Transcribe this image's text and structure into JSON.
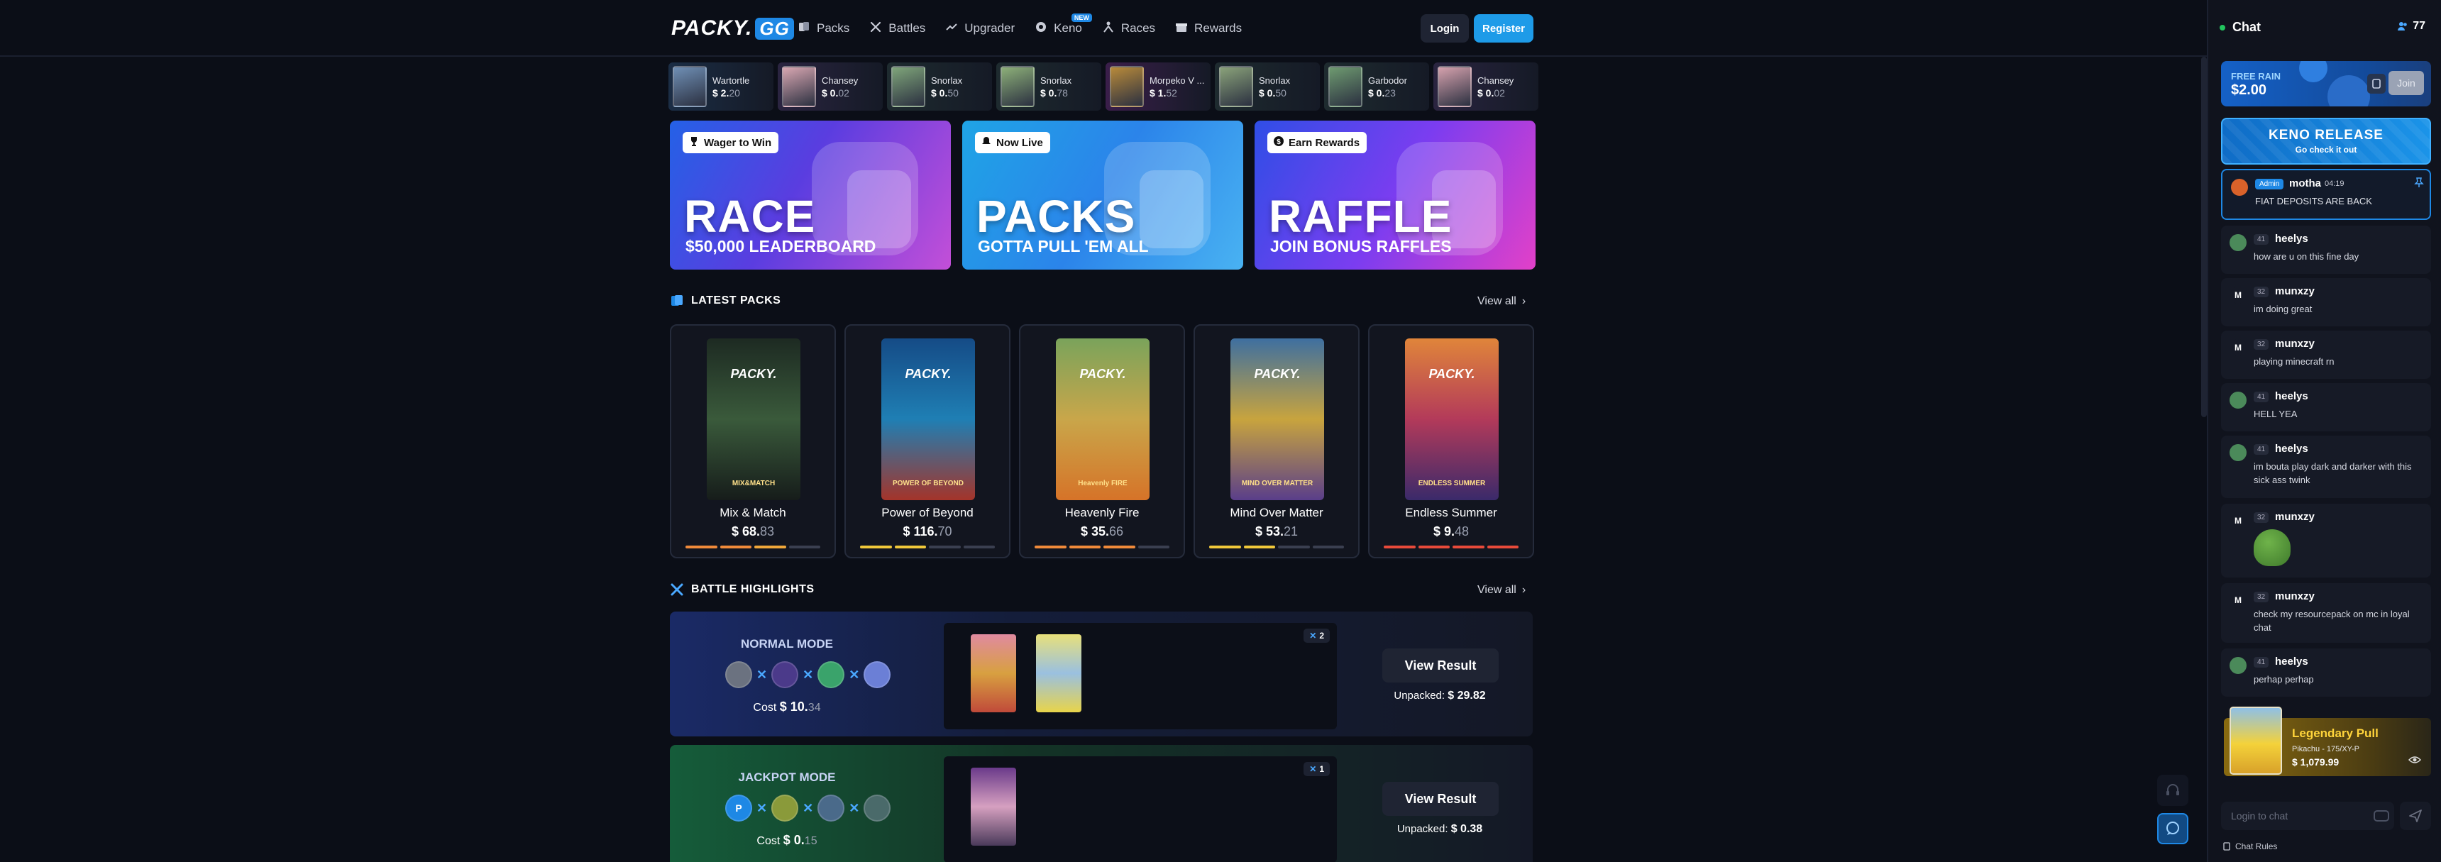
{
  "header": {
    "logo_text": "PACKY.",
    "logo_badge": "GG",
    "nav": [
      {
        "label": "Packs",
        "icon": "cards-icon"
      },
      {
        "label": "Battles",
        "icon": "swords-icon"
      },
      {
        "label": "Upgrader",
        "icon": "trend-up-icon"
      },
      {
        "label": "Keno",
        "icon": "keno-ball-icon",
        "badge": "NEW"
      },
      {
        "label": "Races",
        "icon": "race-icon"
      },
      {
        "label": "Rewards",
        "icon": "gift-icon"
      }
    ],
    "login_label": "Login",
    "register_label": "Register"
  },
  "ticker": [
    {
      "name": "Wartortle",
      "price_int": "$ 2.",
      "price_dec": "20",
      "bg": "#1b2d45",
      "card": "#6f8fb5"
    },
    {
      "name": "Chansey",
      "price_int": "$ 0.",
      "price_dec": "02",
      "bg": "#2a2440",
      "card": "#d9a7b2"
    },
    {
      "name": "Snorlax",
      "price_int": "$ 0.",
      "price_dec": "50",
      "bg": "#1e2b2f",
      "card": "#7fa57a"
    },
    {
      "name": "Snorlax",
      "price_int": "$ 0.",
      "price_dec": "78",
      "bg": "#1e2b2f",
      "card": "#8db079"
    },
    {
      "name": "Morpeko V ...",
      "price_int": "$ 1.",
      "price_dec": "52",
      "bg": "#3a1e4a",
      "card": "#b88a3a"
    },
    {
      "name": "Snorlax",
      "price_int": "$ 0.",
      "price_dec": "50",
      "bg": "#1e2b2f",
      "card": "#8aa27a"
    },
    {
      "name": "Garbodor",
      "price_int": "$ 0.",
      "price_dec": "23",
      "bg": "#1e2b2f",
      "card": "#6e9a70"
    },
    {
      "name": "Chansey",
      "price_int": "$ 0.",
      "price_dec": "02",
      "bg": "#2a2440",
      "card": "#d5a1ad"
    }
  ],
  "banners": [
    {
      "badge": "Wager to Win",
      "icon": "trophy-icon",
      "title": "RACE",
      "subtitle": "$50,000 LEADERBOARD",
      "bg": "linear-gradient(120deg,#2461e6 0%,#5a3de0 45%,#c34fd8 100%)"
    },
    {
      "badge": "Now Live",
      "icon": "bell-icon",
      "title": "PACKS",
      "subtitle": "GOTTA PULL 'EM ALL",
      "bg": "linear-gradient(120deg,#1fa4e6 0%,#2b84ea 50%,#49b2f2 100%)"
    },
    {
      "badge": "Earn Rewards",
      "icon": "dollar-icon",
      "title": "RAFFLE",
      "subtitle": "JOIN BONUS RAFFLES",
      "bg": "linear-gradient(120deg,#2f4ee6 0%,#7b3df0 50%,#e240c8 100%)"
    }
  ],
  "latest_packs": {
    "title": "LATEST PACKS",
    "view_all": "View all",
    "items": [
      {
        "name": "Mix & Match",
        "price_int": "$ 68.",
        "price_dec": "83",
        "art": "linear-gradient(180deg,#1d2a22,#3a5a3b 50%,#161c1a)",
        "label": "MIX&MATCH",
        "bar": [
          "#f08a3a",
          "#f08a3a",
          "#f0a73a",
          "#3a3f50"
        ]
      },
      {
        "name": "Power of Beyond",
        "price_int": "$ 116.",
        "price_dec": "70",
        "art": "linear-gradient(180deg,#154b86,#1f7fb4 50%,#a4342a)",
        "label": "POWER OF BEYOND",
        "bar": [
          "#f0c83a",
          "#f0c83a",
          "#3a3f50",
          "#3a3f50"
        ]
      },
      {
        "name": "Heavenly Fire",
        "price_int": "$ 35.",
        "price_dec": "66",
        "art": "linear-gradient(180deg,#7aa35b,#c9a64a 50%,#d67328)",
        "label": "Heavenly FIRE",
        "bar": [
          "#f08a3a",
          "#f08a3a",
          "#f08a3a",
          "#3a3f50"
        ]
      },
      {
        "name": "Mind Over Matter",
        "price_int": "$ 53.",
        "price_dec": "21",
        "art": "linear-gradient(180deg,#3e6fa0,#c8a43e 50%,#5a3e8a)",
        "label": "MIND OVER MATTER",
        "bar": [
          "#f0c83a",
          "#f0c83a",
          "#3a3f50",
          "#3a3f50"
        ]
      },
      {
        "name": "Endless Summer",
        "price_int": "$ 9.",
        "price_dec": "48",
        "art": "linear-gradient(180deg,#e0853a,#b33a5a 50%,#3a2a6a)",
        "label": "ENDLESS SUMMER",
        "bar": [
          "#e84a3a",
          "#e84a3a",
          "#e84a3a",
          "#e84a3a"
        ]
      }
    ]
  },
  "battle_highlights": {
    "title": "BATTLE HIGHLIGHTS",
    "view_all": "View all",
    "battles": [
      {
        "mode": "NORMAL MODE",
        "cost_label": "Cost",
        "cost_int": "$ 10.",
        "cost_dec": "34",
        "count": "2",
        "view_label": "View Result",
        "unpacked_label": "Unpacked:",
        "unpacked_value": "$ 29.82",
        "bg": "linear-gradient(90deg,#1a2a66 0%,#141d3a 40%,#141826 100%)"
      },
      {
        "mode": "JACKPOT MODE",
        "cost_label": "Cost",
        "cost_int": "$ 0.",
        "cost_dec": "15",
        "count": "1",
        "view_label": "View Result",
        "unpacked_label": "Unpacked:",
        "unpacked_value": "$ 0.38",
        "bg": "linear-gradient(90deg,#155c3a 0%,#133426 40%,#141826 100%)",
        "avatar_letter": "P"
      }
    ]
  },
  "chat": {
    "title": "Chat",
    "online": "77",
    "rain_title": "FREE RAIN",
    "rain_amount": "$2.00",
    "rain_join": "Join",
    "keno_title": "KENO RELEASE",
    "keno_sub": "Go check it out",
    "pinned": {
      "role": "Admin",
      "user": "motha",
      "time": "04:19",
      "text": "FIAT DEPOSITS ARE BACK"
    },
    "messages": [
      {
        "level": "41",
        "user": "heelys",
        "text": "how are u on this fine day",
        "avatar": "#4b8a5a",
        "letter": ""
      },
      {
        "level": "32",
        "user": "munxzy",
        "text": "im doing great",
        "avatar": "#161a26",
        "letter": "M"
      },
      {
        "level": "32",
        "user": "munxzy",
        "text": "playing minecraft rn",
        "avatar": "#161a26",
        "letter": "M"
      },
      {
        "level": "41",
        "user": "heelys",
        "text": "HELL YEA",
        "avatar": "#4b8a5a",
        "letter": ""
      },
      {
        "level": "41",
        "user": "heelys",
        "text": "im bouta play dark and darker with this sick ass twink",
        "avatar": "#4b8a5a",
        "letter": ""
      },
      {
        "level": "32",
        "user": "munxzy",
        "text": "",
        "avatar": "#161a26",
        "letter": "M"
      },
      {
        "level": "32",
        "user": "munxzy",
        "text": "check my resourcepack on mc in loyal chat",
        "avatar": "#161a26",
        "letter": "M"
      },
      {
        "level": "41",
        "user": "heelys",
        "text": "perhap perhap",
        "avatar": "#4b8a5a",
        "letter": ""
      }
    ],
    "legendary_title": "Legendary Pull",
    "legendary_card": "Pikachu - 175/XY-P",
    "legendary_price": "$ 1,079.99",
    "input_placeholder": "Login to chat",
    "rules_label": "Chat Rules"
  }
}
